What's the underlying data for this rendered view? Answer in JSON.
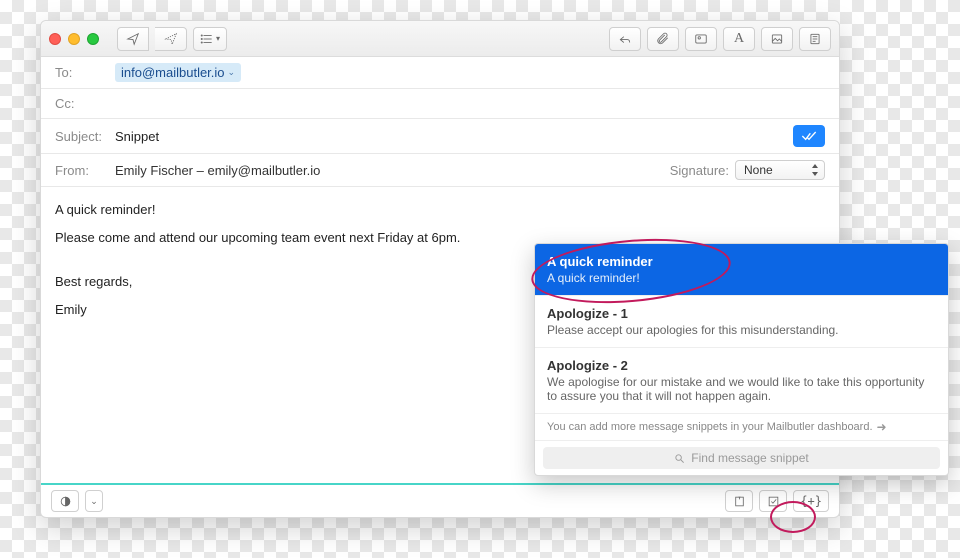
{
  "header": {
    "to_label": "To:",
    "to_value": "info@mailbutler.io",
    "cc_label": "Cc:",
    "subject_label": "Subject:",
    "subject_value": "Snippet",
    "from_label": "From:",
    "from_value": "Emily Fischer – emily@mailbutler.io",
    "signature_label": "Signature:",
    "signature_value": "None"
  },
  "body": {
    "line1": "A quick reminder!",
    "line2": "Please come and attend our upcoming team event next Friday at 6pm.",
    "regards": "Best regards,",
    "name": "Emily"
  },
  "snippets": {
    "items": [
      {
        "title": "A quick reminder",
        "preview": "A quick reminder!"
      },
      {
        "title": "Apologize - 1",
        "preview": "Please accept our apologies for this misunderstanding."
      },
      {
        "title": "Apologize - 2",
        "preview": "We apologise for our mistake and we would like to take this opportunity to assure you that it will not happen again."
      }
    ],
    "hint": "You can add more message snippets in your Mailbutler dashboard.",
    "search_placeholder": "Find message snippet"
  },
  "bottom": {
    "snippet_btn": "{+}"
  }
}
